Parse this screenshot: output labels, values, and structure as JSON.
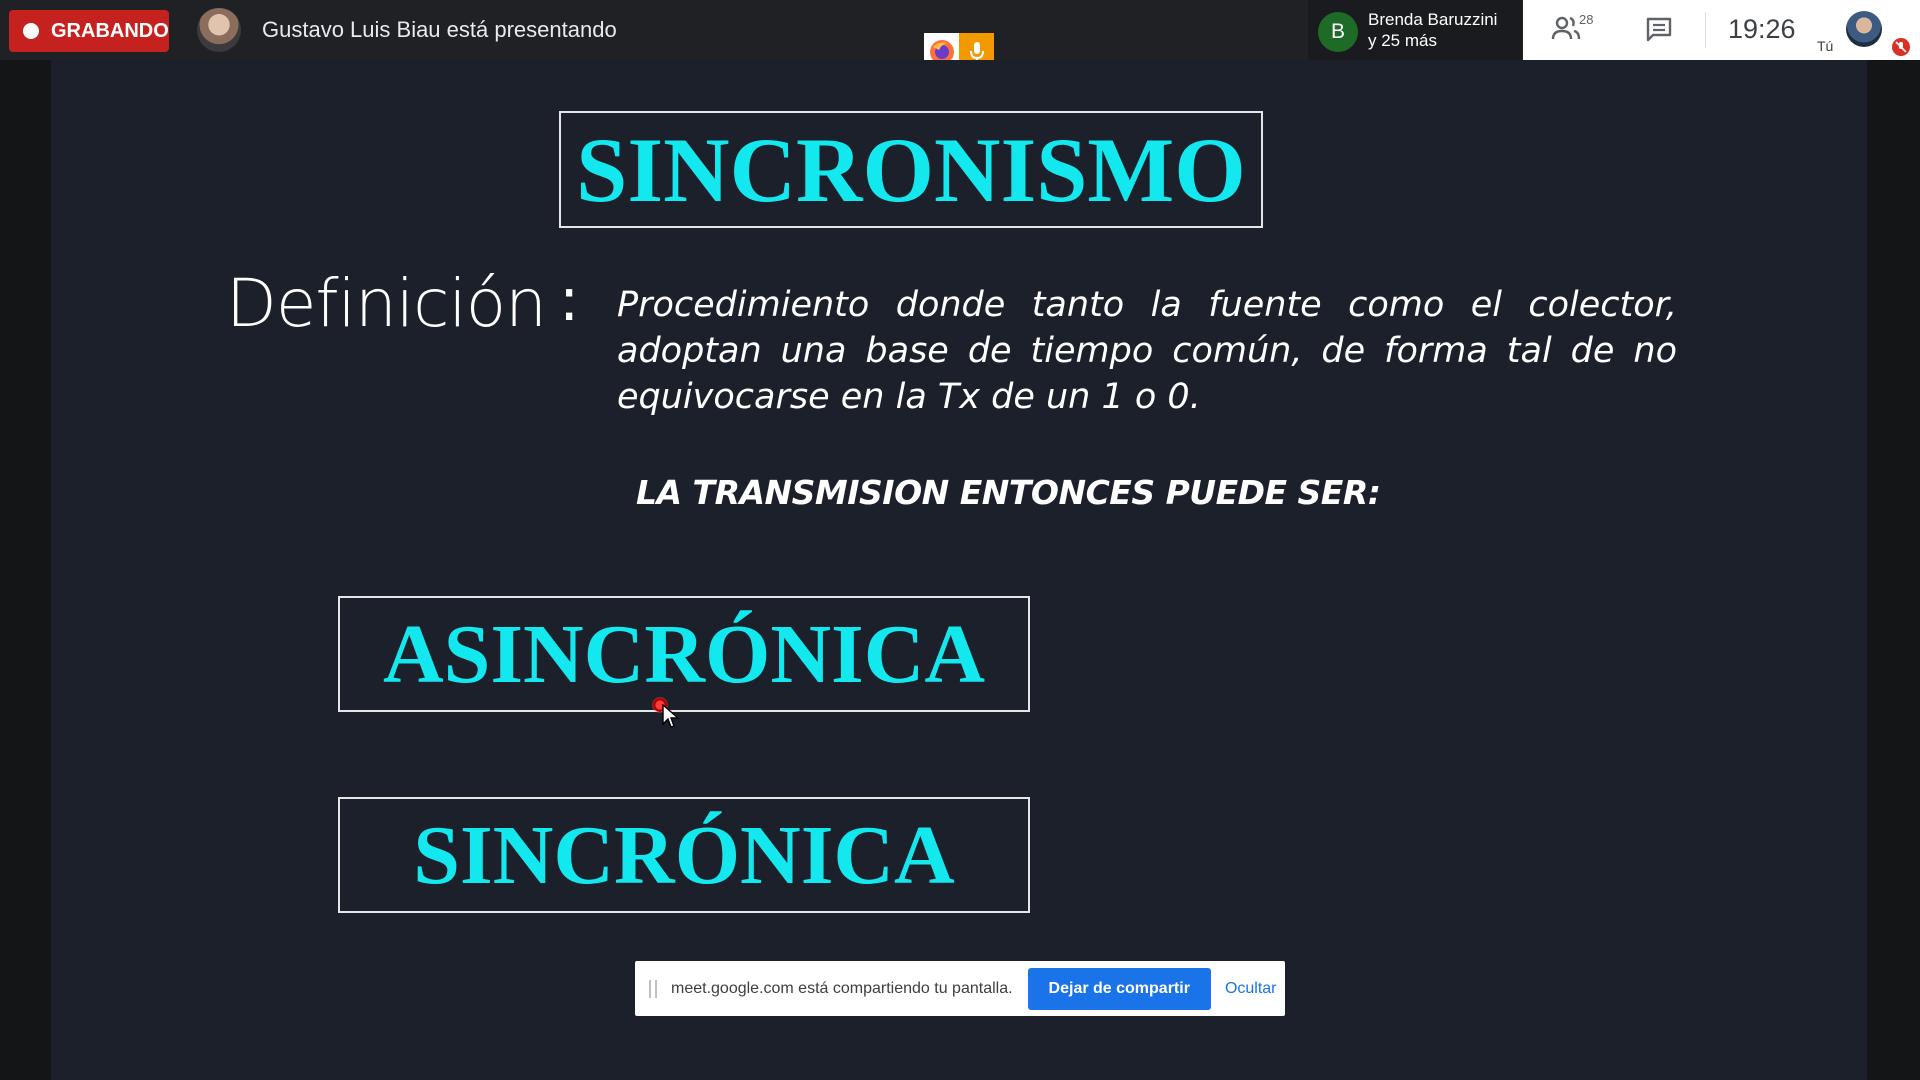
{
  "topbar": {
    "recording_label": "GRABANDO",
    "presenter_text": "Gustavo Luis Biau está presentando",
    "participant": {
      "initial": "B",
      "name": "Brenda Baruzzini",
      "more": "y 25 más"
    },
    "people_count": "28",
    "time": "19:26",
    "self_label": "Tú",
    "icons": [
      "record-dot-icon",
      "firefox-icon",
      "microphone-icon",
      "people-icon",
      "chat-icon",
      "mic-muted-icon"
    ]
  },
  "slide": {
    "title": "SINCRONISMO",
    "definition_label": "Definición",
    "definition_colon": ":",
    "definition_text": "Procedimiento donde tanto la fuente como el colector, adoptan una base de tiempo común, de forma tal de no equivocarse en la Tx de un 1 o 0.",
    "transmission_heading": "LA TRANSMISION ENTONCES PUEDE SER:",
    "option_async": "ASINCRÓNICA",
    "option_sync": "SINCRÓNICA"
  },
  "share_banner": {
    "message": "meet.google.com está compartiendo tu pantalla.",
    "stop_button": "Dejar de compartir",
    "hide_link": "Ocultar"
  },
  "colors": {
    "accent_cyan": "#14e8ef",
    "recording_red": "#c5221f",
    "share_blue": "#1a73e8",
    "slide_bg": "#1b202b"
  }
}
